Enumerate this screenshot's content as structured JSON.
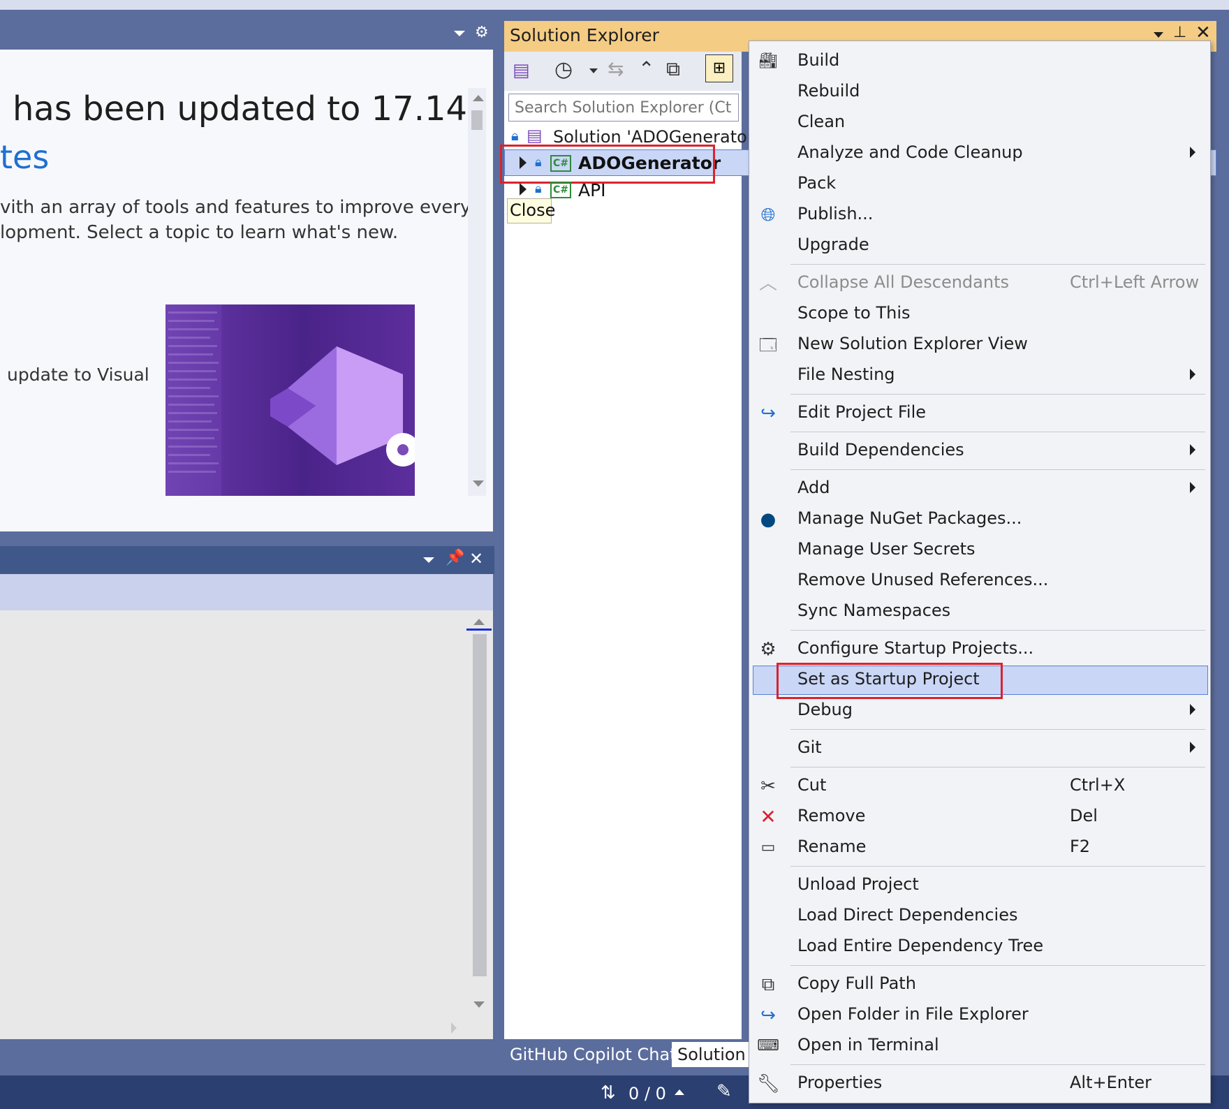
{
  "left_panel": {
    "title": "has been updated to 17.14",
    "link": "tes",
    "body_line1": "vith an array of tools and features to improve every",
    "body_line2": "lopment. Select a topic to learn what's new.",
    "update_text": "update to Visual"
  },
  "solution_explorer": {
    "title": "Solution Explorer",
    "search_placeholder": "Search Solution Explorer (Ctrl+;)",
    "solution_label": "Solution 'ADOGenerator' (",
    "projects": [
      {
        "name": "ADOGenerator",
        "selected": true
      },
      {
        "name": "API",
        "selected": false
      }
    ],
    "tooltip": "Close",
    "lang_badge": "C#"
  },
  "tabs": [
    {
      "label": "GitHub Copilot Chat",
      "active": false
    },
    {
      "label": "Solution E",
      "active": true
    }
  ],
  "status_bar": {
    "sync": "0 / 0"
  },
  "context_menu": {
    "items": [
      {
        "label": "Build",
        "icon": "build-icon"
      },
      {
        "label": "Rebuild"
      },
      {
        "label": "Clean"
      },
      {
        "label": "Analyze and Code Cleanup",
        "submenu": true
      },
      {
        "label": "Pack"
      },
      {
        "label": "Publish...",
        "icon": "globe-icon"
      },
      {
        "label": "Upgrade"
      },
      {
        "label": "Collapse All Descendants",
        "shortcut": "Ctrl+Left Arrow",
        "disabled": true,
        "icon": "chevron-up-icon"
      },
      {
        "label": "Scope to This"
      },
      {
        "label": "New Solution Explorer View",
        "icon": "new-view-icon"
      },
      {
        "label": "File Nesting",
        "submenu": true
      },
      {
        "label": "Edit Project File",
        "icon": "redo-arrow-icon"
      },
      {
        "label": "Build Dependencies",
        "submenu": true
      },
      {
        "label": "Add",
        "submenu": true
      },
      {
        "label": "Manage NuGet Packages...",
        "icon": "nuget-icon"
      },
      {
        "label": "Manage User Secrets"
      },
      {
        "label": "Remove Unused References..."
      },
      {
        "label": "Sync Namespaces"
      },
      {
        "label": "Configure Startup Projects...",
        "icon": "gear-icon"
      },
      {
        "label": "Set as Startup Project",
        "highlighted": true
      },
      {
        "label": "Debug",
        "submenu": true
      },
      {
        "label": "Git",
        "submenu": true
      },
      {
        "label": "Cut",
        "shortcut": "Ctrl+X",
        "icon": "scissors-icon"
      },
      {
        "label": "Remove",
        "shortcut": "Del",
        "icon": "red-x-icon"
      },
      {
        "label": "Rename",
        "shortcut": "F2",
        "icon": "rename-icon"
      },
      {
        "label": "Unload Project"
      },
      {
        "label": "Load Direct Dependencies"
      },
      {
        "label": "Load Entire Dependency Tree"
      },
      {
        "label": "Copy Full Path",
        "icon": "copy-icon"
      },
      {
        "label": "Open Folder in File Explorer",
        "icon": "redo-arrow-icon"
      },
      {
        "label": "Open in Terminal",
        "icon": "terminal-icon"
      },
      {
        "label": "Properties",
        "shortcut": "Alt+Enter",
        "icon": "wrench-icon"
      }
    ]
  },
  "colors": {
    "frame": "#5b6d9c",
    "se_title": "#f5cc84",
    "selection": "#c9d6f6",
    "callout_red": "#d9232e",
    "link_blue": "#1f6fd0"
  }
}
